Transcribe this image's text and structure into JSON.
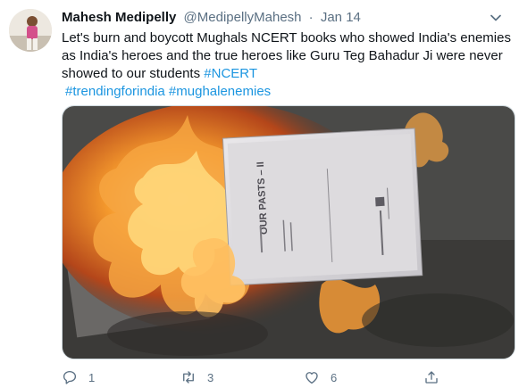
{
  "tweet": {
    "author": {
      "display_name": "Mahesh Medipelly",
      "handle": "@MedipellyMahesh",
      "separator": "·",
      "date": "Jan 14"
    },
    "text": {
      "line1": "Let's burn and boycott Mughals NCERT books who showed India's enemies",
      "line2": "as India's heroes and the true heroes like Guru Teg Bahadur Ji were never",
      "line3": "showed to our students",
      "hashtags_inline": [
        "#NCERT"
      ],
      "hashtags_line4": [
        "#trendingforindia",
        "#mughalenemies"
      ]
    },
    "media": {
      "book_title": "OUR PASTS – II"
    },
    "actions": {
      "reply": {
        "icon": "reply-icon",
        "count": "1"
      },
      "retweet": {
        "icon": "retweet-icon",
        "count": "3"
      },
      "like": {
        "icon": "heart-icon",
        "count": "6"
      },
      "share": {
        "icon": "share-icon"
      }
    }
  },
  "colors": {
    "text": "#0f1419",
    "secondary": "#5b7083",
    "link": "#1b95e0"
  }
}
